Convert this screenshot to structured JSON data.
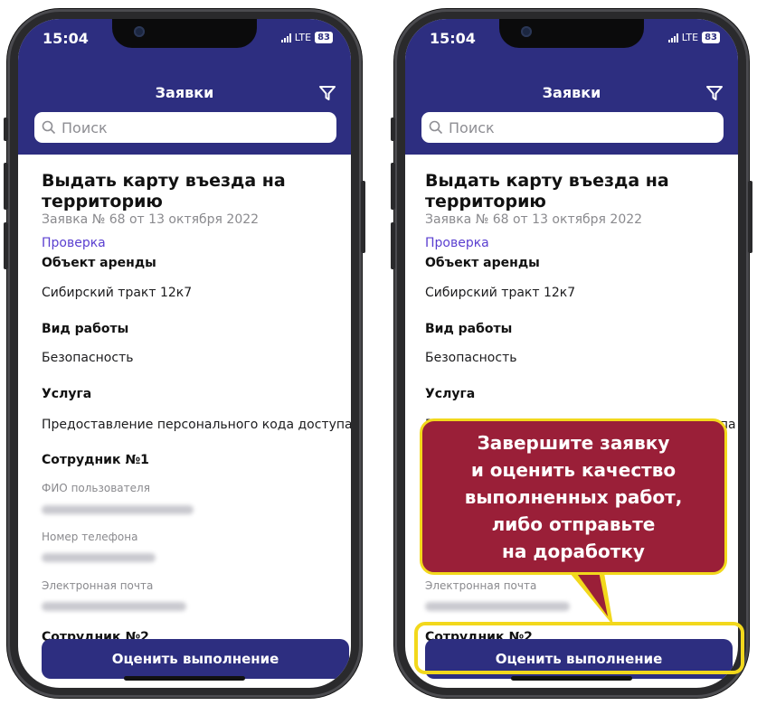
{
  "status_bar": {
    "time": "15:04",
    "network": "LTE",
    "battery": "83"
  },
  "header": {
    "title": "Заявки",
    "search_placeholder": "Поиск"
  },
  "request": {
    "title": "Выдать карту въезда на территорию",
    "number_line": "Заявка № 68 от 13 октября 2022",
    "status": "Проверка",
    "fields": [
      {
        "label": "Объект аренды",
        "value": "Сибирский тракт 12к7"
      },
      {
        "label": "Вид работы",
        "value": "Безопасность"
      },
      {
        "label": "Услуга",
        "value": "Предоставление персонального кода доступа"
      }
    ],
    "employee": {
      "heading": "Сотрудник №1",
      "name_label": "ФИО пользователя",
      "phone_label": "Номер телефона",
      "email_label": "Электронная почта",
      "next_heading_partial": "Сотрудник №2"
    }
  },
  "action_button": "Оценить выполнение",
  "callout": {
    "lines": [
      "Завершите заявку",
      "и оценить качество",
      "выполненных работ,",
      "либо отправьте",
      "на доработку"
    ]
  },
  "colors": {
    "brand": "#2d2e80",
    "callout": "#9a1f38",
    "highlight": "#f2d81c",
    "status": "#5a3fd0"
  }
}
